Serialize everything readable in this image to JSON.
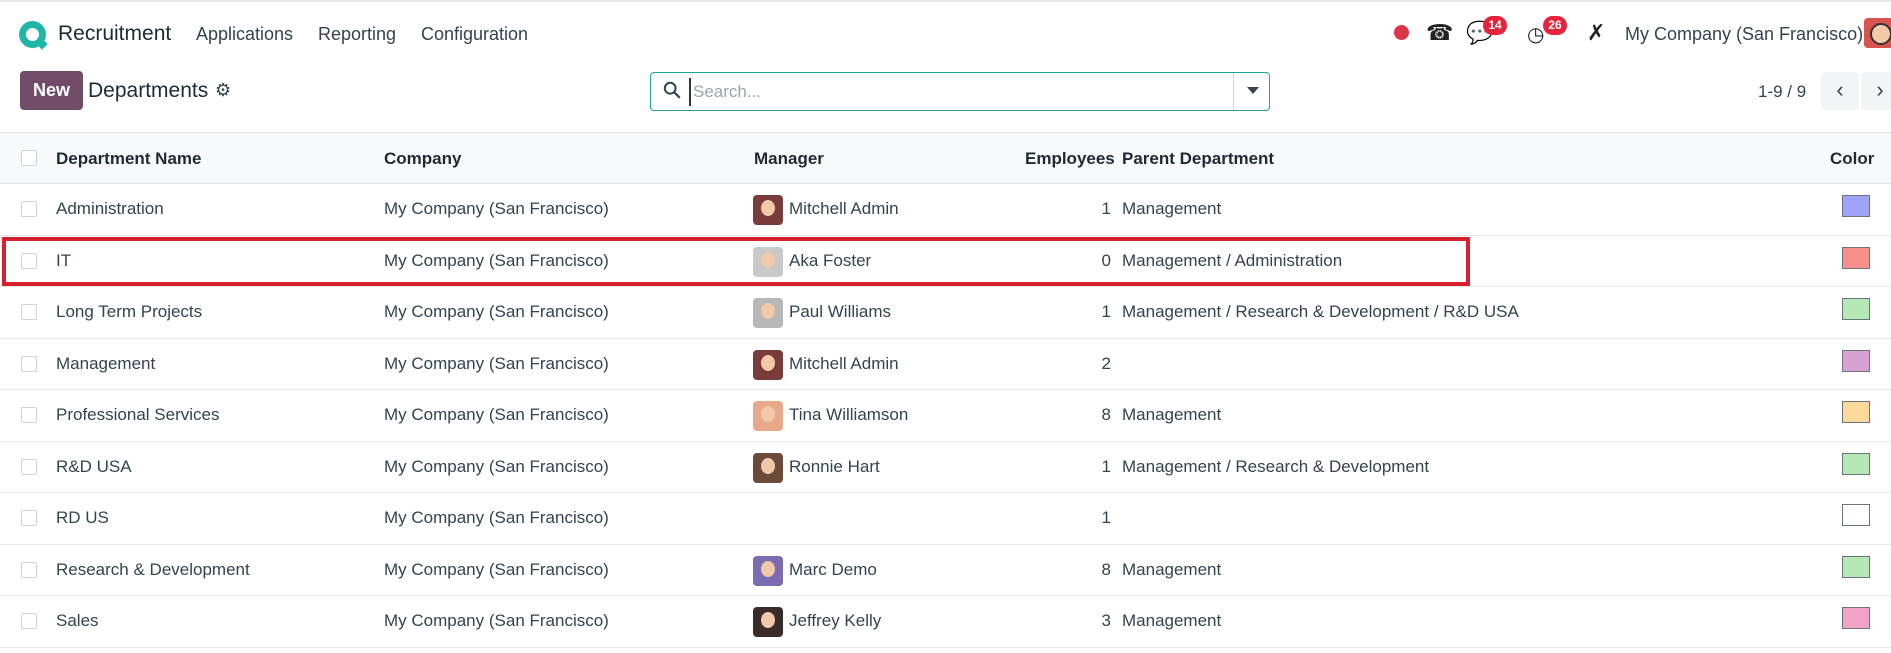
{
  "topbar": {
    "app_name": "Recruitment",
    "menu": [
      "Applications",
      "Reporting",
      "Configuration"
    ],
    "messages_count": "14",
    "activities_count": "26",
    "company": "My Company (San Francisco)"
  },
  "control": {
    "new_label": "New",
    "title": "Departments",
    "search_placeholder": "Search...",
    "pager": "1-9 / 9"
  },
  "table": {
    "headers": {
      "name": "Department Name",
      "company": "Company",
      "manager": "Manager",
      "employees": "Employees",
      "parent": "Parent Department",
      "color": "Color"
    },
    "rows": [
      {
        "name": "Administration",
        "company": "My Company (San Francisco)",
        "manager": "Mitchell Admin",
        "avatar": "#7a3b3b",
        "employees": "1",
        "parent": "Management",
        "color": "#9fa4f7"
      },
      {
        "name": "IT",
        "company": "My Company (San Francisco)",
        "manager": "Aka Foster",
        "avatar": "#c9c9c9",
        "employees": "0",
        "parent": "Management / Administration",
        "color": "#f7908a"
      },
      {
        "name": "Long Term Projects",
        "company": "My Company (San Francisco)",
        "manager": "Paul Williams",
        "avatar": "#b8b8b8",
        "employees": "1",
        "parent": "Management / Research & Development / R&D USA",
        "color": "#b4e8b4"
      },
      {
        "name": "Management",
        "company": "My Company (San Francisco)",
        "manager": "Mitchell Admin",
        "avatar": "#7a3b3b",
        "employees": "2",
        "parent": "",
        "color": "#d6a2d2"
      },
      {
        "name": "Professional Services",
        "company": "My Company (San Francisco)",
        "manager": "Tina Williamson",
        "avatar": "#e8a98a",
        "employees": "8",
        "parent": "Management",
        "color": "#fbd99a"
      },
      {
        "name": "R&D USA",
        "company": "My Company (San Francisco)",
        "manager": "Ronnie Hart",
        "avatar": "#6b4a3a",
        "employees": "1",
        "parent": "Management / Research & Development",
        "color": "#b4e8b4"
      },
      {
        "name": "RD US",
        "company": "My Company (San Francisco)",
        "manager": "",
        "avatar": "",
        "employees": "1",
        "parent": "",
        "color": "#ffffff"
      },
      {
        "name": "Research & Development",
        "company": "My Company (San Francisco)",
        "manager": "Marc Demo",
        "avatar": "#7b6bb0",
        "employees": "8",
        "parent": "Management",
        "color": "#b4e8b4"
      },
      {
        "name": "Sales",
        "company": "My Company (San Francisco)",
        "manager": "Jeffrey Kelly",
        "avatar": "#3a2b2b",
        "employees": "3",
        "parent": "Management",
        "color": "#f2a2c6"
      }
    ]
  }
}
